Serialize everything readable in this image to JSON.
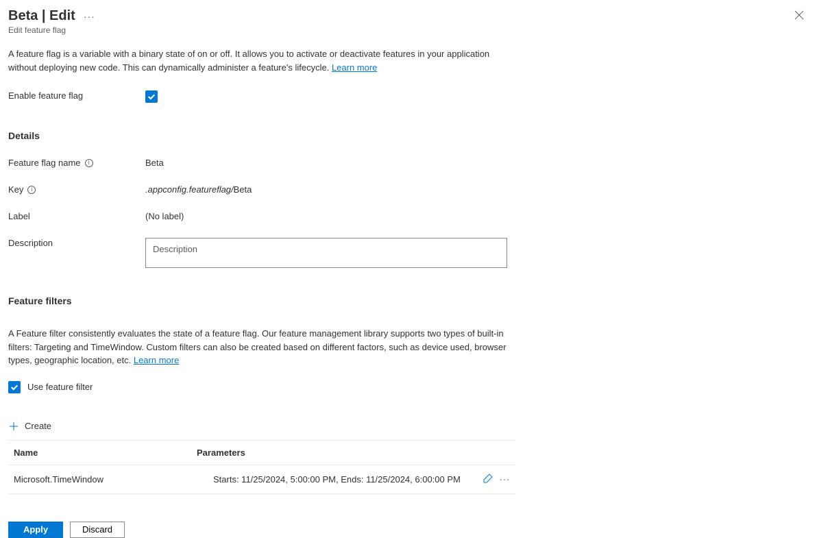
{
  "header": {
    "title": "Beta | Edit",
    "subtitle": "Edit feature flag"
  },
  "intro": {
    "text": "A feature flag is a variable with a binary state of on or off. It allows you to activate or deactivate features in your application without deploying new code. This can dynamically administer a feature's lifecycle. ",
    "learn_more": "Learn more"
  },
  "enable": {
    "label": "Enable feature flag"
  },
  "details": {
    "heading": "Details",
    "name_label": "Feature flag name",
    "name_value": "Beta",
    "key_label": "Key",
    "key_prefix": ".appconfig.featureflag/",
    "key_suffix": "Beta",
    "label_label": "Label",
    "label_value": "(No label)",
    "description_label": "Description",
    "description_placeholder": "Description"
  },
  "filters": {
    "heading": "Feature filters",
    "intro": "A Feature filter consistently evaluates the state of a feature flag. Our feature management library supports two types of built-in filters: Targeting and TimeWindow. Custom filters can also be created based on different factors, such as device used, browser types, geographic location, etc. ",
    "learn_more": "Learn more",
    "use_label": "Use feature filter",
    "create_label": "Create",
    "columns": {
      "name": "Name",
      "parameters": "Parameters"
    },
    "rows": [
      {
        "name": "Microsoft.TimeWindow",
        "parameters": "Starts: 11/25/2024, 5:00:00 PM, Ends: 11/25/2024, 6:00:00 PM"
      }
    ]
  },
  "footer": {
    "apply": "Apply",
    "discard": "Discard"
  }
}
